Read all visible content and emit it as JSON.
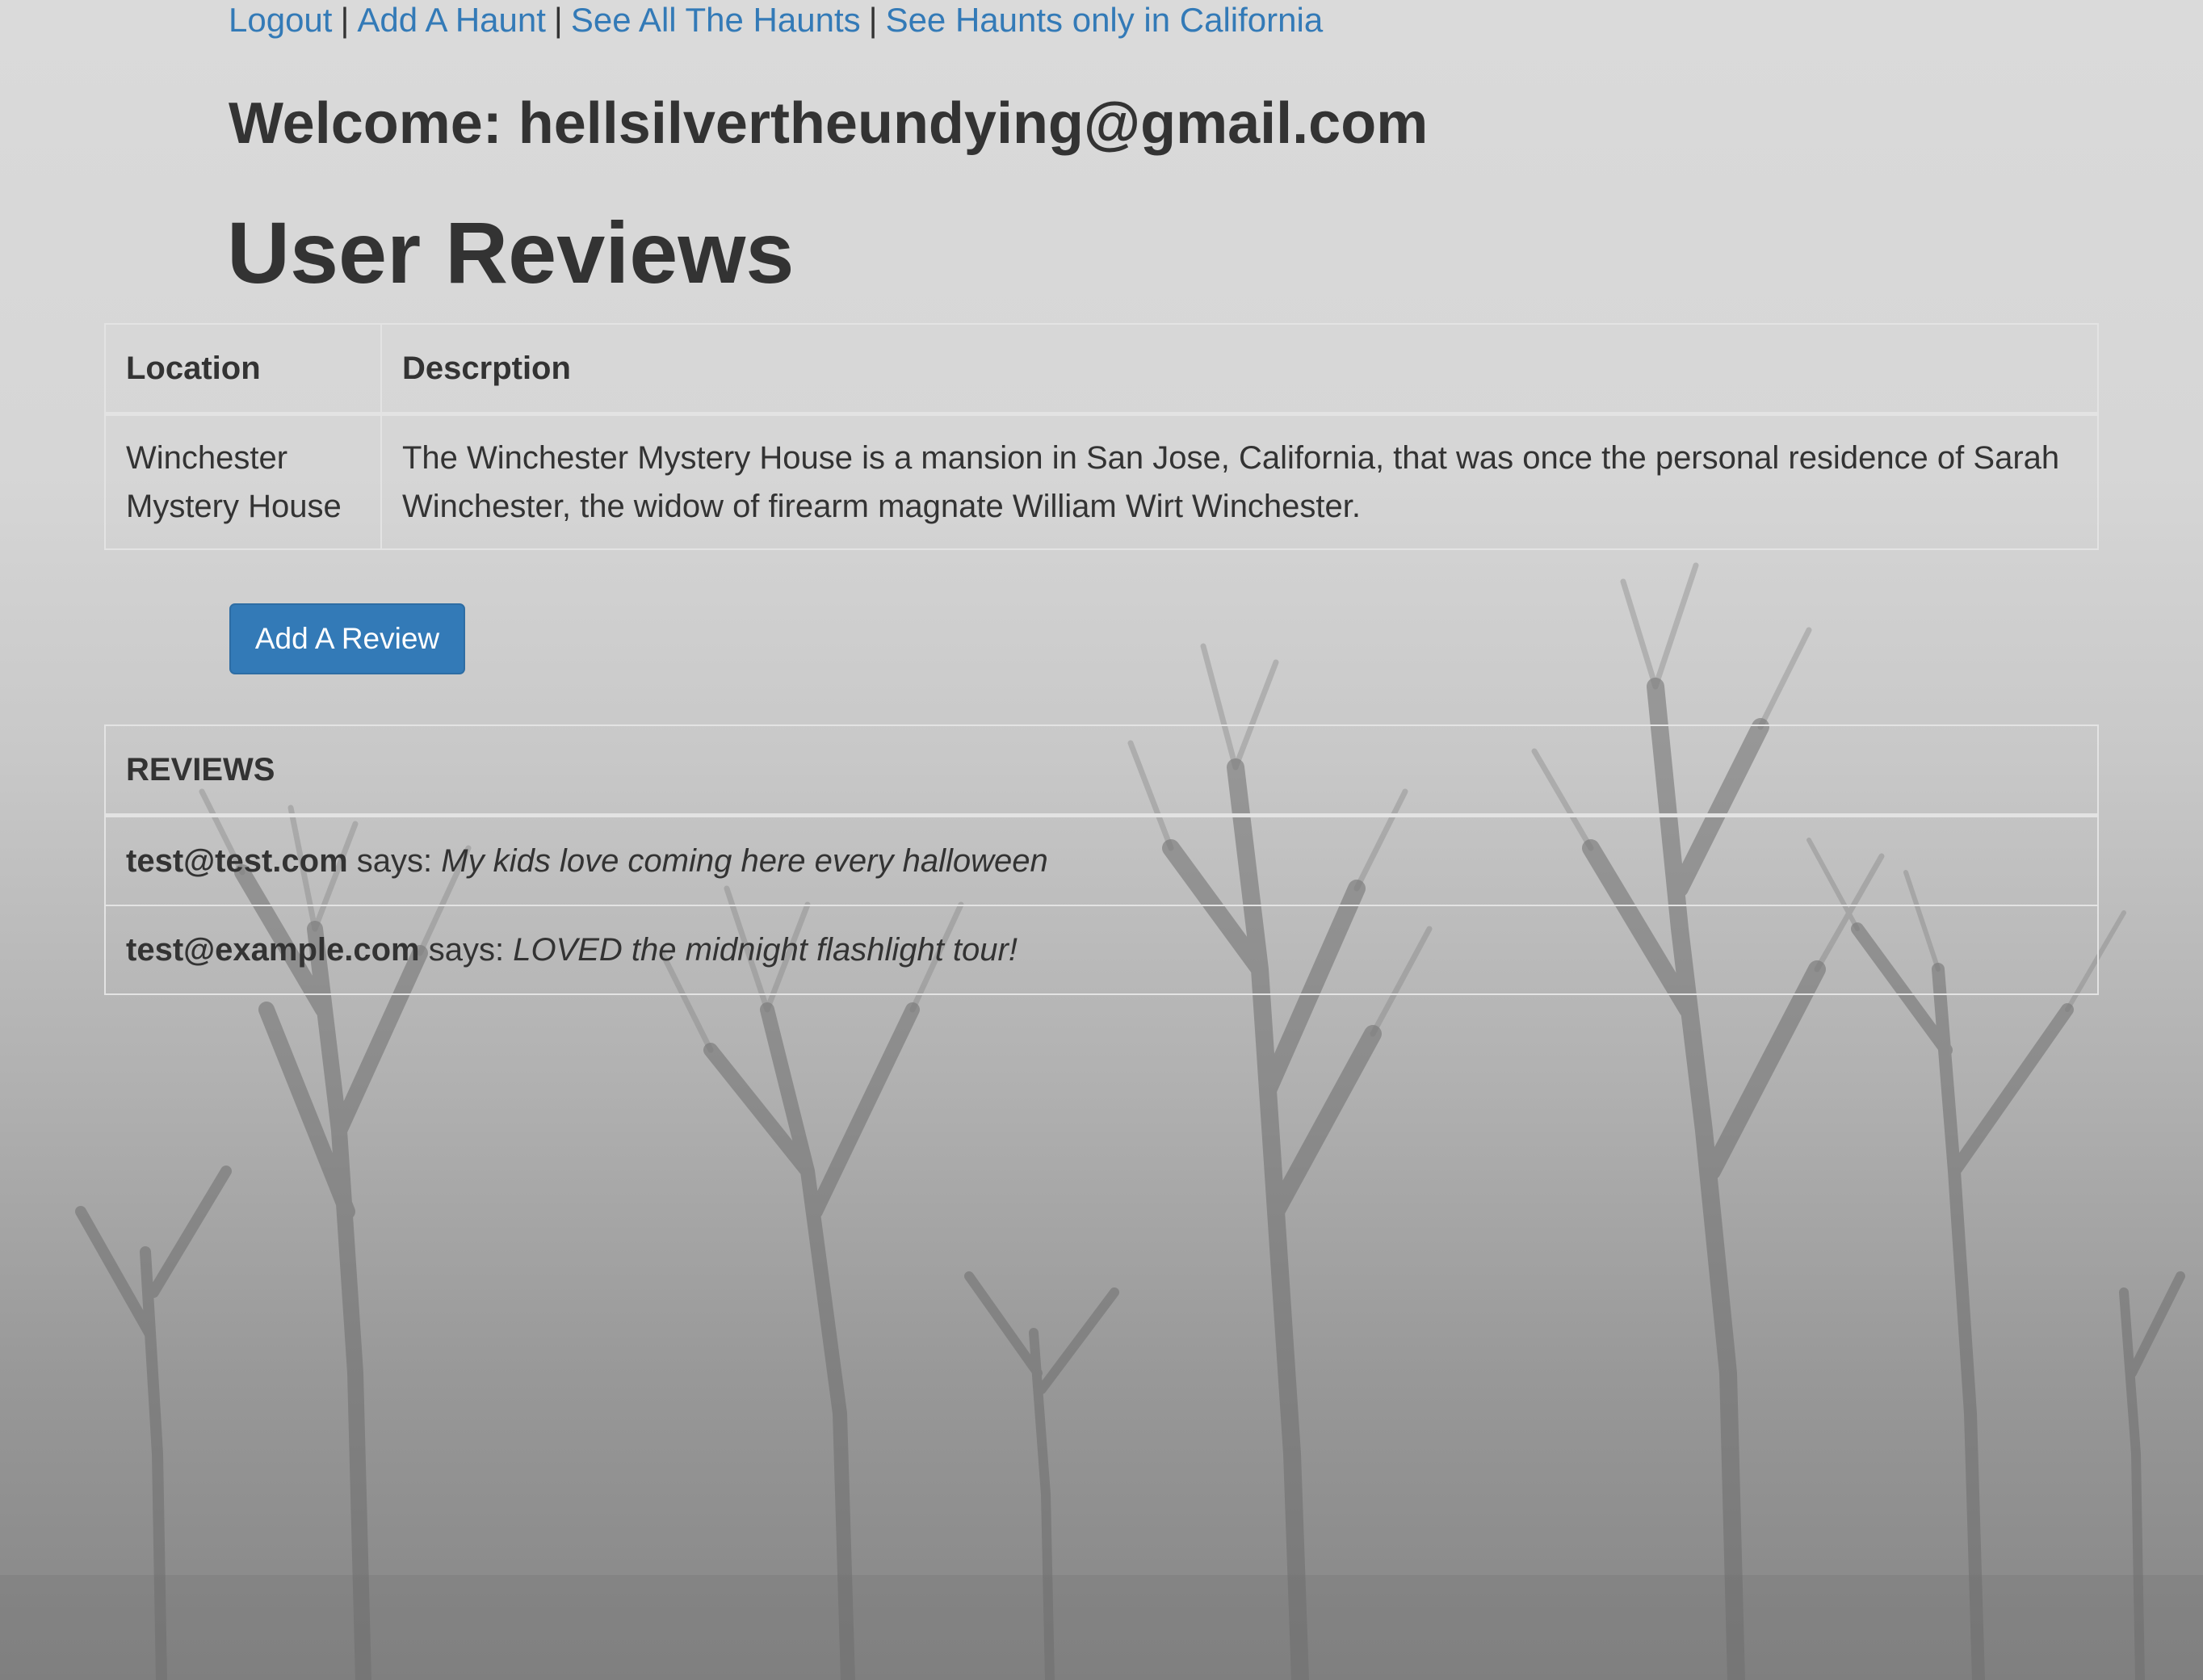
{
  "nav": {
    "links": [
      {
        "label": "Logout"
      },
      {
        "label": "Add A Haunt"
      },
      {
        "label": "See All The Haunts"
      },
      {
        "label": "See Haunts only in California"
      }
    ],
    "separator": "|"
  },
  "welcome": "Welcome: hellsilvertheundying@gmail.com",
  "page_title": "User Reviews",
  "haunt_table": {
    "headers": [
      "Location",
      "Descrption"
    ],
    "rows": [
      {
        "location": "Winchester Mystery House",
        "description": "The Winchester Mystery House is a mansion in San Jose, California, that was once the personal residence of Sarah Winchester, the widow of firearm magnate William Wirt Winchester."
      }
    ]
  },
  "add_review_button": "Add A Review",
  "reviews": {
    "header": "REVIEWS",
    "says": "says:",
    "items": [
      {
        "user": "test@test.com",
        "text": "My kids love coming here every halloween"
      },
      {
        "user": "test@example.com",
        "text": "LOVED the midnight flashlight tour!"
      }
    ]
  },
  "colors": {
    "link": "#337ab7",
    "button": "#337ab7",
    "text": "#333333",
    "table_border": "#e3e3e3"
  }
}
